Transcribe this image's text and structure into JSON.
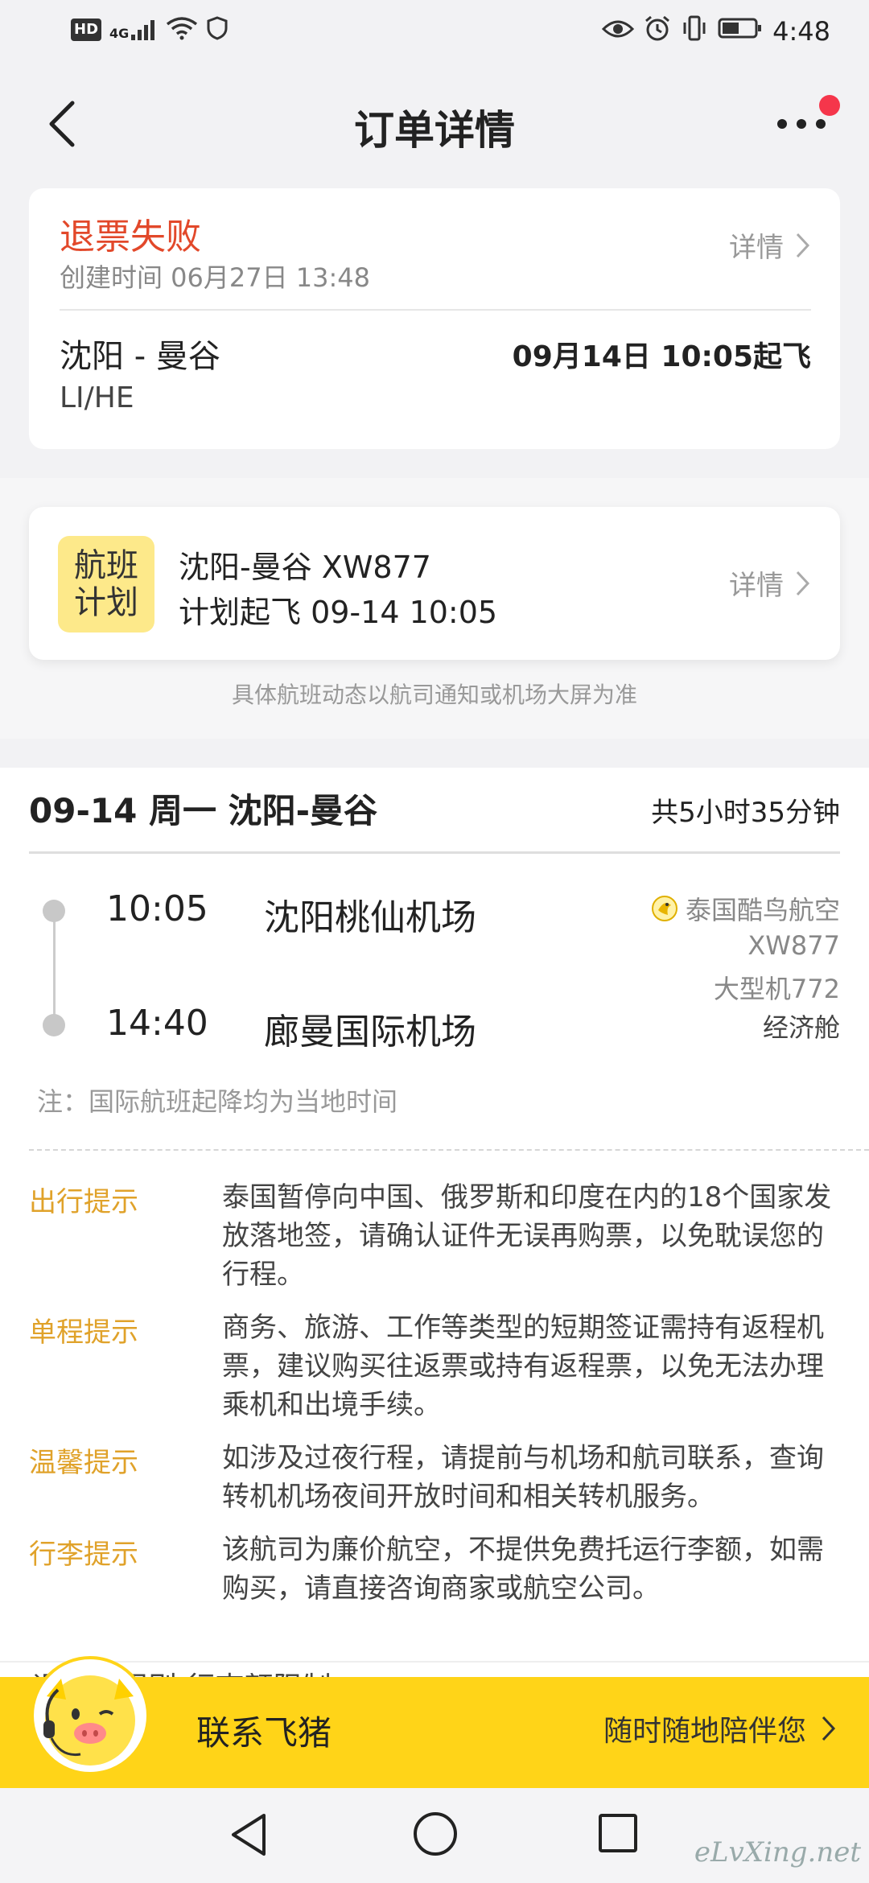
{
  "status_bar": {
    "hd": "HD",
    "network": "4G",
    "time": "4:48"
  },
  "header": {
    "title": "订单详情"
  },
  "order": {
    "status": "退票失败",
    "created": "创建时间 06月27日 13:48",
    "detail_label": "详情",
    "route": "沈阳 - 曼谷",
    "passenger": "LI/HE",
    "departure": "09月14日 10:05起飞"
  },
  "flight_plan": {
    "badge_line1": "航班",
    "badge_line2": "计划",
    "line1": "沈阳-曼谷 XW877",
    "line2": "计划起飞 09-14 10:05",
    "detail_label": "详情",
    "notice": "具体航班动态以航司通知或机场大屏为准"
  },
  "segment": {
    "heading": "09-14 周一 沈阳-曼谷",
    "duration": "共5小时35分钟",
    "dep_time": "10:05",
    "dep_airport": "沈阳桃仙机场",
    "arr_time": "14:40",
    "arr_airport": "廊曼国际机场",
    "airline": "泰国酷鸟航空",
    "flight_no": "XW877",
    "aircraft": "大型机772",
    "cabin": "经济舱",
    "note": "注：国际航班起降均为当地时间"
  },
  "tips": [
    {
      "label": "出行提示",
      "text": "泰国暂停向中国、俄罗斯和印度在内的18个国家发放落地签，请确认证件无误再购票，以免耽误您的行程。"
    },
    {
      "label": "单程提示",
      "text": "商务、旅游、工作等类型的短期签证需持有返程机票，建议购买往返票或持有返程票，以免无法办理乘机和出境手续。"
    },
    {
      "label": "温馨提示",
      "text": "如涉及过夜行程，请提前与机场和航司联系，查询转机机场夜间开放时间和相关转机服务。"
    },
    {
      "label": "行李提示",
      "text": "该航司为廉价航空，不提供免费托运行李额，如需购买，请直接咨询商家或航空公司。"
    }
  ],
  "partial_text": "退改签规则 行李额限制",
  "contact": {
    "label": "联系飞猪",
    "sub": "随时随地陪伴您"
  },
  "watermark": "eLvXing.net",
  "colors": {
    "status_red": "#e2482a",
    "tip_orange": "#e0a22a",
    "contact_yellow": "#ffd418",
    "badge_yellow": "#fde98a"
  }
}
